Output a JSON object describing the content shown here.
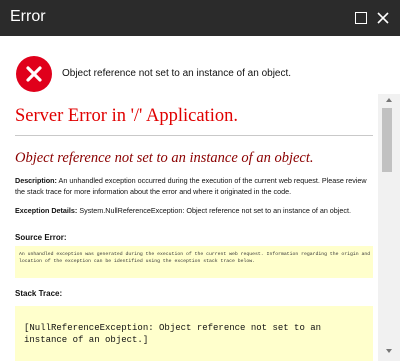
{
  "window": {
    "title": "Error",
    "maximize_icon": "maximize-icon",
    "close_icon": "close-icon"
  },
  "header": {
    "icon": "error-circle-x-icon",
    "icon_color": "#e0001b",
    "message": "Object reference not set to an instance of an object."
  },
  "page": {
    "heading": "Server Error in '/' Application.",
    "subheading": "Object reference not set to an instance of an object.",
    "description_label": "Description:",
    "description_text": "An unhandled exception occurred during the execution of the current web request. Please review the stack trace for more information about the error and where it originated in the code.",
    "exception_label": "Exception Details:",
    "exception_text": "System.NullReferenceException: Object reference not set to an instance of an object.",
    "source_error_label": "Source Error:",
    "source_error_text": "An unhandled exception was generated during the execution of the current web request. Information regarding the origin and location of the exception can be identified using the exception stack trace below.",
    "stack_trace_label": "Stack Trace:",
    "stack_trace_text": "[NullReferenceException: Object reference not set to an instance of an object.]"
  },
  "colors": {
    "titlebar": "#2b2b2b",
    "heading": "#e00000",
    "subheading": "#8b0000",
    "code_background": "#ffffcc"
  }
}
